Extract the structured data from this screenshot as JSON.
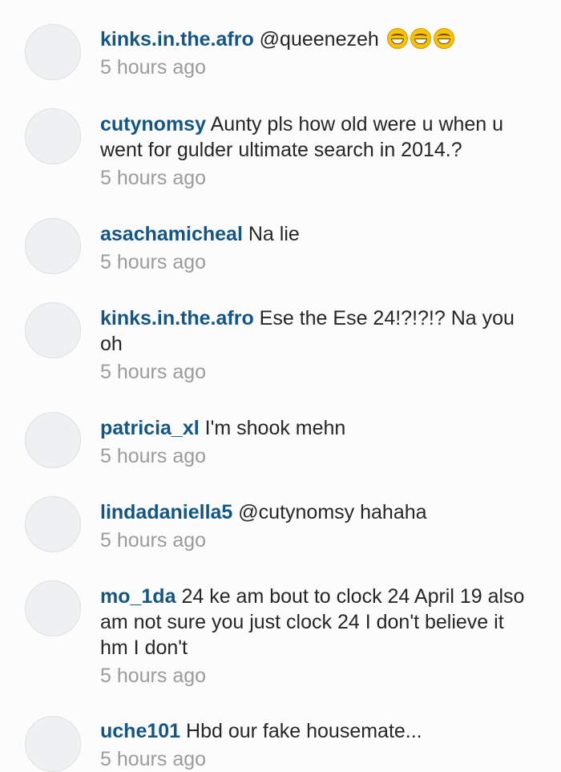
{
  "comments": [
    {
      "username": "kinks.in.the.afro",
      "text": "@queenezeh",
      "emoji": "grinning-squinting-face-icon",
      "emoji_count": 3,
      "time": "5 hours ago"
    },
    {
      "username": "cutynomsy",
      "text": "Aunty pls how old were u when u went for gulder ultimate search in 2014.?",
      "time": "5 hours ago"
    },
    {
      "username": "asachamicheal",
      "text": "Na lie",
      "time": "5 hours ago"
    },
    {
      "username": "kinks.in.the.afro",
      "text": "Ese the Ese 24!?!?!? Na you oh",
      "time": "5 hours ago"
    },
    {
      "username": "patricia_xl",
      "text": "I'm shook mehn",
      "time": "5 hours ago"
    },
    {
      "username": "lindadaniella5",
      "text": "@cutynomsy hahaha",
      "time": "5 hours ago"
    },
    {
      "username": "mo_1da",
      "text": "24 ke am bout to clock 24 April 19 also am not sure you just clock 24 I don't believe it hm I don't",
      "time": "5 hours ago"
    },
    {
      "username": "uche101",
      "text": "Hbd our fake housemate...",
      "time": "5 hours ago"
    }
  ]
}
